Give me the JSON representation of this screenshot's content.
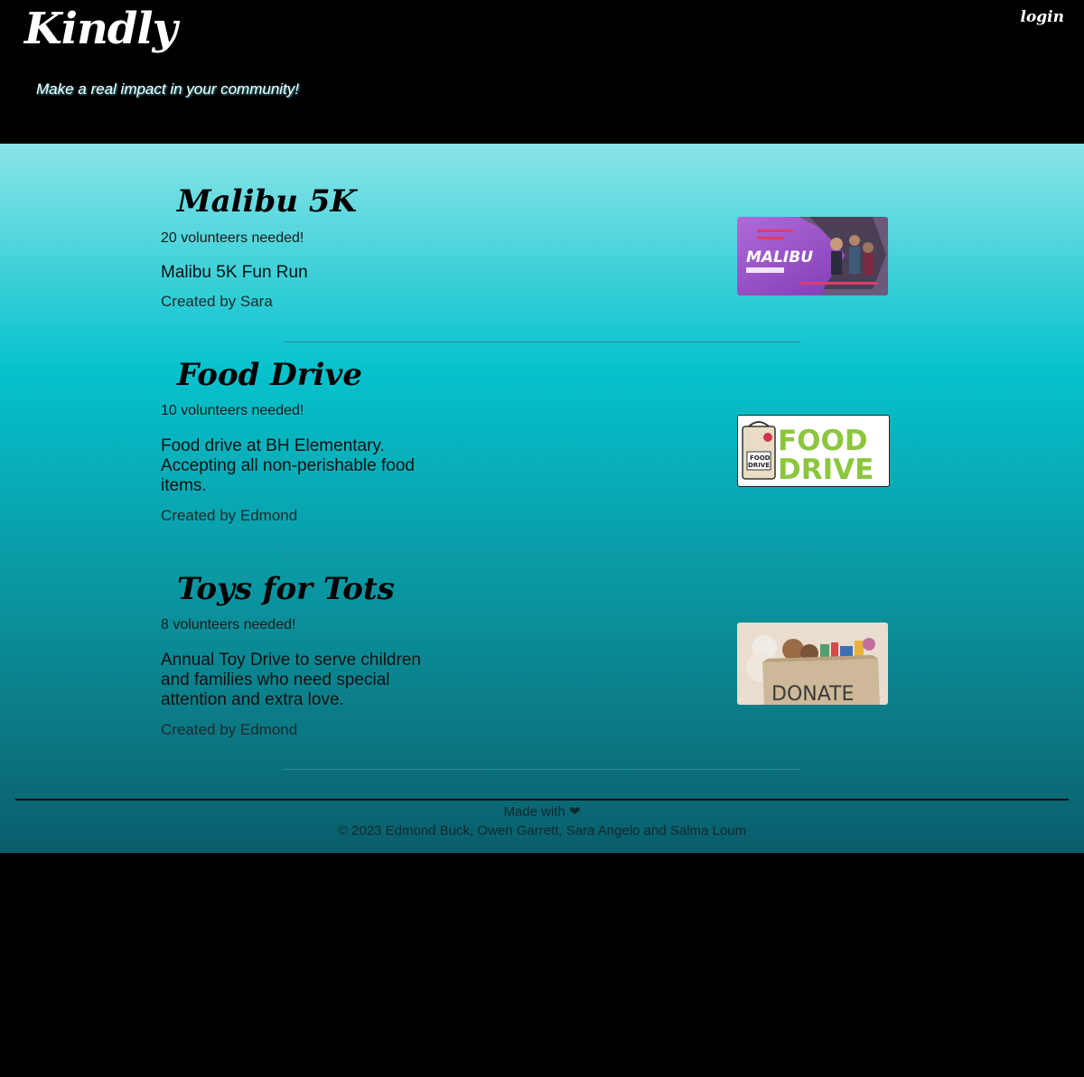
{
  "header": {
    "logo": "Kindly",
    "tagline": "Make a real impact in your community!",
    "login_label": "login"
  },
  "events": [
    {
      "title": "Malibu 5K",
      "volunteers": "20 volunteers needed!",
      "description": "Malibu 5K Fun Run",
      "created_by": "Created by Sara",
      "image_text": "MALIBU"
    },
    {
      "title": "Food Drive",
      "volunteers": "10 volunteers needed!",
      "description": "Food drive at BH Elementary. Accepting all non-perishable food items.",
      "created_by": "Created by Edmond",
      "image_text": "FOOD DRIVE"
    },
    {
      "title": "Toys for Tots",
      "volunteers": "8 volunteers needed!",
      "description": "Annual Toy Drive to serve children and families who need special attention and extra love.",
      "created_by": "Created by Edmond",
      "image_text": "DONATE"
    }
  ],
  "footer": {
    "made_with": "Made with ❤",
    "copyright": "© 2023 Edmond Buck, Owen Garrett, Sara Angelo and Salma Loum"
  },
  "colors": {
    "header_bg": "#000000",
    "gradient_top": "#8ae4e8",
    "gradient_mid": "#05c2cd",
    "gradient_bottom": "#0a5d6b",
    "food_green": "#8cc63f",
    "malibu_purple": "#9b4fc9"
  }
}
